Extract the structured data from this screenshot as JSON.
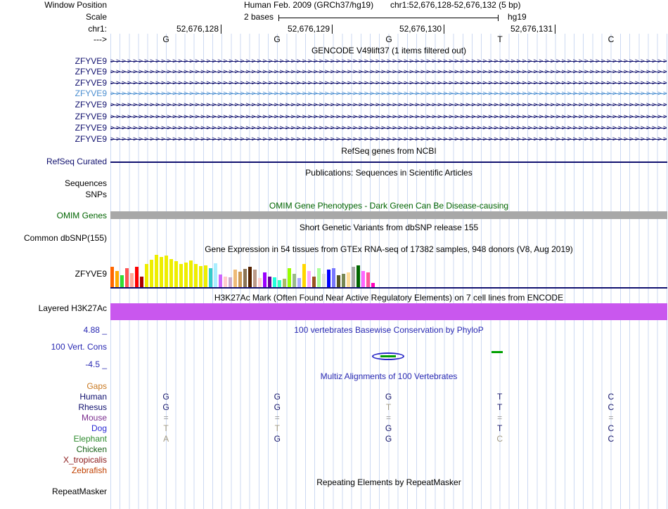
{
  "header": {
    "window_position_label": "Window Position",
    "assembly": "Human Feb. 2009 (GRCh37/hg19)",
    "position": "chr1:52,676,128-52,676,132 (5 bp)",
    "scale_label": "Scale",
    "scale_text": "2 bases",
    "assembly_short": "hg19",
    "chrom_label": "chr1:",
    "coordinates": [
      "52,676,128",
      "52,676,129",
      "52,676,130",
      "52,676,131"
    ],
    "strand_arrow": "--->",
    "bases": [
      "G",
      "G",
      "G",
      "T",
      "C"
    ]
  },
  "tracks": {
    "gencode": {
      "title": "GENCODE V49lift37 (1 items filtered out)",
      "transcripts": [
        {
          "label": "ZFYVE9",
          "color": "#10106e"
        },
        {
          "label": "ZFYVE9",
          "color": "#10106e"
        },
        {
          "label": "ZFYVE9",
          "color": "#10106e"
        },
        {
          "label": "ZFYVE9",
          "color": "#4c8fd1"
        },
        {
          "label": "ZFYVE9",
          "color": "#10106e"
        },
        {
          "label": "ZFYVE9",
          "color": "#10106e"
        },
        {
          "label": "ZFYVE9",
          "color": "#10106e"
        },
        {
          "label": "ZFYVE9",
          "color": "#10106e"
        }
      ]
    },
    "refseq": {
      "title": "RefSeq genes from NCBI",
      "label": "RefSeq Curated",
      "color": "#10106e"
    },
    "publications": {
      "title": "Publications: Sequences in Scientific Articles",
      "sequences_label": "Sequences",
      "snps_label": "SNPs"
    },
    "omim": {
      "title": "OMIM Gene Phenotypes - Dark Green Can Be Disease-causing",
      "label": "OMIM Genes",
      "title_color": "#006400",
      "bar_color": "#a8a8a8"
    },
    "dbsnp": {
      "title": "Short Genetic Variants from dbSNP release 155",
      "label": "Common dbSNP(155)"
    },
    "gtex": {
      "title": "Gene Expression in 54 tissues from GTEx RNA-seq of 17382 samples, 948 donors (V8, Aug 2019)",
      "label": "ZFYVE9"
    },
    "h3k27ac": {
      "title": "H3K27Ac Mark (Often Found Near Active Regulatory Elements) on 7 cell lines from ENCODE",
      "label": "Layered H3K27Ac",
      "bar_color": "#c957ee"
    },
    "phylop": {
      "title": "100 vertebrates Basewise Conservation by PhyloP",
      "label": "100 Vert. Cons",
      "max_label": "4.88 _",
      "min_label": "-4.5 _",
      "label_color": "#2828b2"
    },
    "multiz": {
      "title": "Multiz Alignments of 100 Vertebrates",
      "title_color": "#2828b2",
      "letter_color": "#16166b",
      "dim_color": "#a39b85",
      "equals_color": "#999999",
      "rows": [
        {
          "label": "Gaps",
          "color": "#c87820",
          "bases": [
            "",
            "",
            "",
            "",
            ""
          ],
          "dim": [
            false,
            false,
            false,
            false,
            false
          ]
        },
        {
          "label": "Human",
          "color": "#10106e",
          "bases": [
            "G",
            "G",
            "G",
            "T",
            "C"
          ],
          "dim": [
            false,
            false,
            false,
            false,
            false
          ]
        },
        {
          "label": "Rhesus",
          "color": "#10106e",
          "bases": [
            "G",
            "G",
            "T",
            "T",
            "C"
          ],
          "dim": [
            false,
            false,
            true,
            false,
            false
          ]
        },
        {
          "label": "Mouse",
          "color": "#7b2d8e",
          "bases": [
            "=",
            "=",
            "=",
            "=",
            "="
          ],
          "dim": [
            true,
            true,
            true,
            true,
            true
          ]
        },
        {
          "label": "Dog",
          "color": "#2a2ad4",
          "bases": [
            "T",
            "T",
            "G",
            "T",
            "C"
          ],
          "dim": [
            true,
            true,
            false,
            false,
            false
          ]
        },
        {
          "label": "Elephant",
          "color": "#2e8b2e",
          "bases": [
            "A",
            "G",
            "G",
            "C",
            "C"
          ],
          "dim": [
            true,
            false,
            false,
            true,
            false
          ]
        },
        {
          "label": "Chicken",
          "color": "#176117",
          "bases": [
            "",
            "",
            "",
            "",
            ""
          ],
          "dim": [
            false,
            false,
            false,
            false,
            false
          ]
        },
        {
          "label": "X_tropicalis",
          "color": "#8b1a1a",
          "bases": [
            "",
            "",
            "",
            "",
            ""
          ],
          "dim": [
            false,
            false,
            false,
            false,
            false
          ]
        },
        {
          "label": "Zebrafish",
          "color": "#c04000",
          "bases": [
            "",
            "",
            "",
            "",
            ""
          ],
          "dim": [
            false,
            false,
            false,
            false,
            false
          ]
        }
      ]
    },
    "repeatmasker": {
      "title": "Repeating Elements by RepeatMasker",
      "label": "RepeatMasker"
    }
  },
  "chart_data": {
    "type": "bar",
    "title": "Gene Expression in 54 tissues from GTEx RNA-seq of 17382 samples, 948 donors (V8, Aug 2019)",
    "gene": "ZFYVE9",
    "n_bars": 54,
    "units": "relative expression bar height (px, est.)",
    "ylim": [
      0,
      47
    ],
    "bars": [
      {
        "color": "#FF6600",
        "h": 29
      },
      {
        "color": "#FFAA00",
        "h": 23
      },
      {
        "color": "#33DD33",
        "h": 17
      },
      {
        "color": "#FF5555",
        "h": 27
      },
      {
        "color": "#FFAA99",
        "h": 20
      },
      {
        "color": "#FF0000",
        "h": 29
      },
      {
        "color": "#AA0000",
        "h": 15
      },
      {
        "color": "#EEEE00",
        "h": 33
      },
      {
        "color": "#EEEE00",
        "h": 39
      },
      {
        "color": "#EEEE00",
        "h": 46
      },
      {
        "color": "#EEEE00",
        "h": 43
      },
      {
        "color": "#EEEE00",
        "h": 45
      },
      {
        "color": "#EEEE00",
        "h": 40
      },
      {
        "color": "#EEEE00",
        "h": 37
      },
      {
        "color": "#EEEE00",
        "h": 33
      },
      {
        "color": "#EEEE00",
        "h": 35
      },
      {
        "color": "#EEEE00",
        "h": 38
      },
      {
        "color": "#EEEE00",
        "h": 33
      },
      {
        "color": "#EEEE00",
        "h": 30
      },
      {
        "color": "#EEEE00",
        "h": 31
      },
      {
        "color": "#33CCCC",
        "h": 27
      },
      {
        "color": "#AAEEFF",
        "h": 34
      },
      {
        "color": "#CC66FF",
        "h": 18
      },
      {
        "color": "#FFCCCC",
        "h": 15
      },
      {
        "color": "#CCAACC",
        "h": 14
      },
      {
        "color": "#EEBB77",
        "h": 25
      },
      {
        "color": "#CC9955",
        "h": 22
      },
      {
        "color": "#8B7355",
        "h": 26
      },
      {
        "color": "#552200",
        "h": 29
      },
      {
        "color": "#BB9988",
        "h": 25
      },
      {
        "color": "#FFCCCC",
        "h": 13
      },
      {
        "color": "#9900FF",
        "h": 21
      },
      {
        "color": "#660099",
        "h": 15
      },
      {
        "color": "#22FFDD",
        "h": 14
      },
      {
        "color": "#33FFC2",
        "h": 10
      },
      {
        "color": "#AABB66",
        "h": 12
      },
      {
        "color": "#99FF00",
        "h": 27
      },
      {
        "color": "#99BB88",
        "h": 19
      },
      {
        "color": "#AAAAFF",
        "h": 13
      },
      {
        "color": "#FFD700",
        "h": 33
      },
      {
        "color": "#FFAAFF",
        "h": 23
      },
      {
        "color": "#995522",
        "h": 15
      },
      {
        "color": "#AAFF99",
        "h": 27
      },
      {
        "color": "#DDDDDD",
        "h": 19
      },
      {
        "color": "#0000FF",
        "h": 25
      },
      {
        "color": "#7777FF",
        "h": 27
      },
      {
        "color": "#555522",
        "h": 17
      },
      {
        "color": "#778855",
        "h": 19
      },
      {
        "color": "#FFDD99",
        "h": 21
      },
      {
        "color": "#AAAAAA",
        "h": 29
      },
      {
        "color": "#006600",
        "h": 31
      },
      {
        "color": "#FF66FF",
        "h": 23
      },
      {
        "color": "#FF5599",
        "h": 21
      },
      {
        "color": "#FF00BB",
        "h": 6
      }
    ]
  }
}
